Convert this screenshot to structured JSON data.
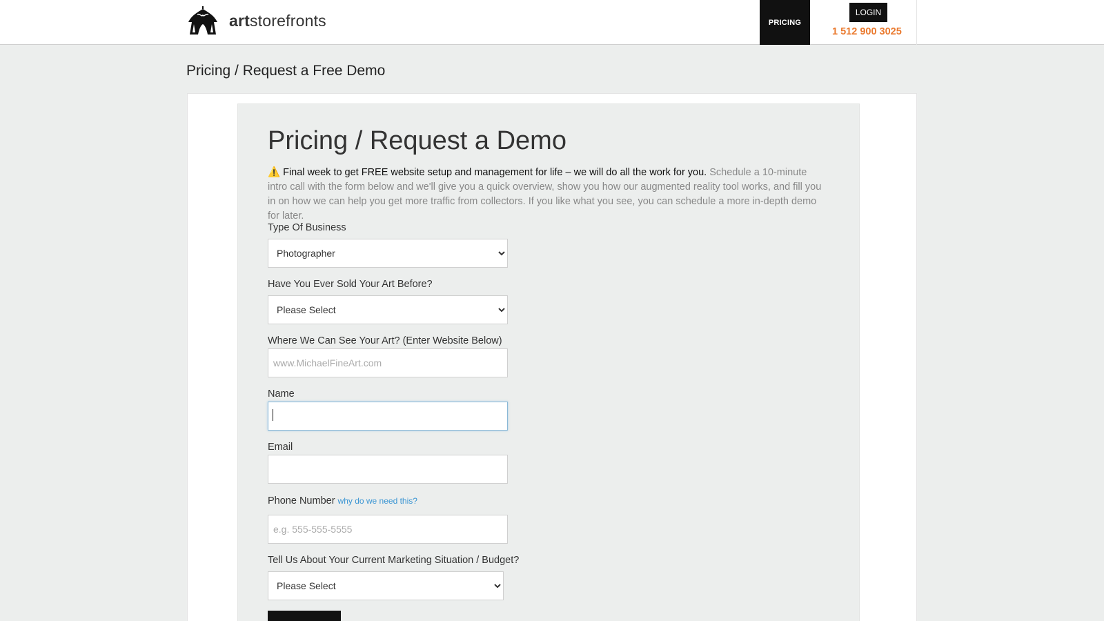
{
  "header": {
    "logo_bold": "art",
    "logo_rest": "storefronts",
    "nav_pricing": "PRICING",
    "login": "LOGIN",
    "phone": "1 512 900 3025"
  },
  "page_heading": "Pricing / Request a Free Demo",
  "form": {
    "title": "Pricing / Request a Demo",
    "intro_alert": "⚠️ Final week to get FREE website setup and management for life – we will do all the work for you.",
    "intro_body": "Schedule a 10-minute intro call with the form below and we'll give you a quick overview, show you how our augmented reality tool works, and fill you in on how we can help you get more traffic from collectors. If you like what you see, you can schedule a more in-depth demo for later.",
    "business_type": {
      "label": "Type Of Business",
      "value": "Photographer"
    },
    "sold_before": {
      "label": "Have You Ever Sold Your Art Before?",
      "value": "Please Select"
    },
    "website": {
      "label": "Where We Can See Your Art? (Enter Website Below)",
      "placeholder": "www.MichaelFineArt.com"
    },
    "name": {
      "label": "Name",
      "value": ""
    },
    "email": {
      "label": "Email",
      "value": ""
    },
    "phone": {
      "label": "Phone Number",
      "why": "why do we need this?",
      "placeholder": "e.g. 555-555-5555"
    },
    "marketing": {
      "label": "Tell Us About Your Current Marketing Situation / Budget?",
      "value": "Please Select"
    }
  },
  "colors": {
    "accent_orange": "#ea7a2f",
    "link_blue": "#3a95d3",
    "dark": "#111111",
    "background": "#eceeed"
  },
  "icons": {
    "logo": "circus-tent-icon"
  }
}
